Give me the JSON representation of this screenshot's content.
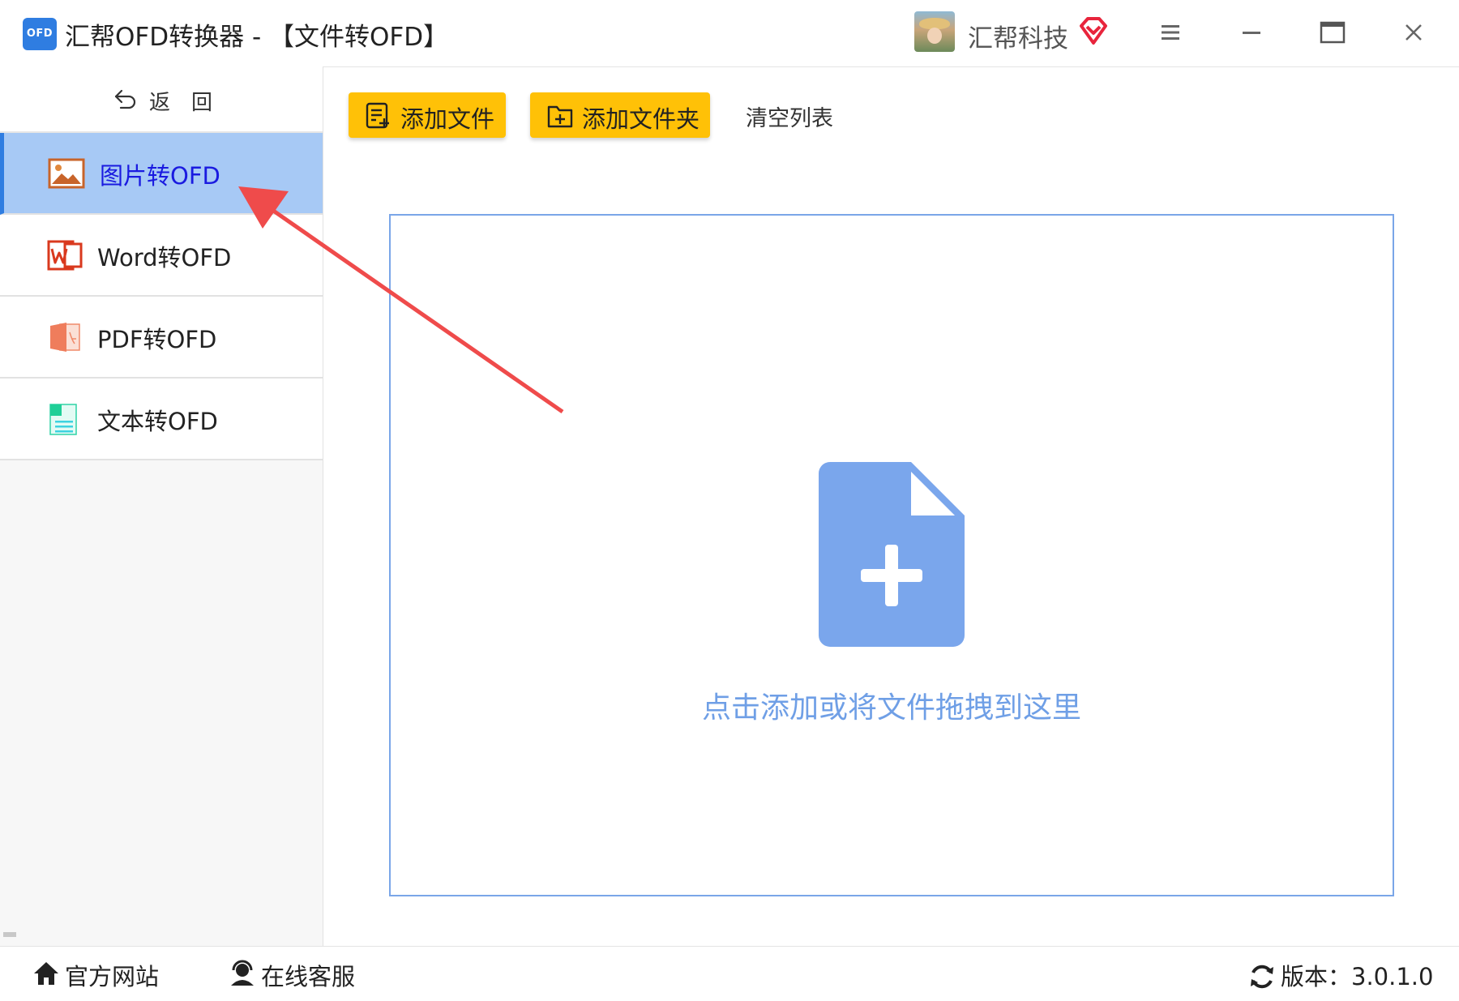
{
  "window": {
    "logo_text": "OFD",
    "title": "汇帮OFD转换器 - 【文件转OFD】",
    "user_name": "汇帮科技"
  },
  "sidebar": {
    "back_label": "返回",
    "items": [
      {
        "label": "图片转OFD",
        "icon": "image-icon",
        "active": true
      },
      {
        "label": "Word转OFD",
        "icon": "word-icon",
        "active": false
      },
      {
        "label": "PDF转OFD",
        "icon": "pdf-icon",
        "active": false
      },
      {
        "label": "文本转OFD",
        "icon": "text-file-icon",
        "active": false
      }
    ]
  },
  "toolbar": {
    "add_file_label": "添加文件",
    "add_folder_label": "添加文件夹",
    "clear_label": "清空列表"
  },
  "drop_zone": {
    "hint": "点击添加或将文件拖拽到这里"
  },
  "statusbar": {
    "website_label": "官方网站",
    "service_label": "在线客服",
    "version_label": "版本：3.0.1.0"
  },
  "colors": {
    "accent": "#2f7de1",
    "active_item_bg": "#a7c9f5",
    "button_yellow": "#ffc107",
    "drop_icon": "#7aa6ec",
    "annotation_arrow": "#ef4b4b"
  }
}
